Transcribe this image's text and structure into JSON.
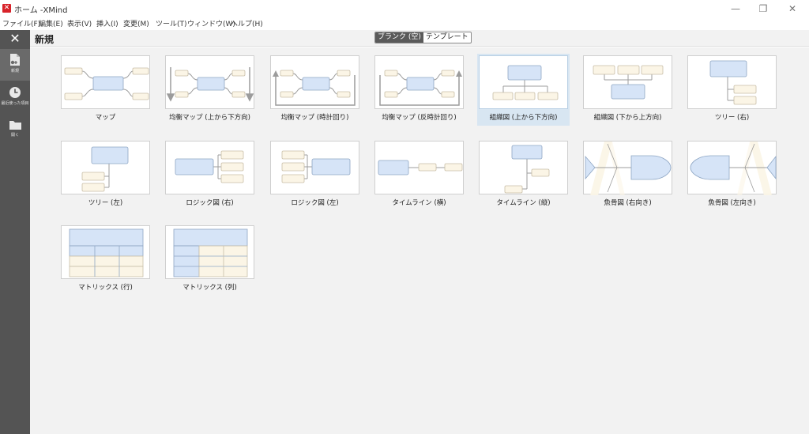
{
  "window": {
    "title": "ホーム -XMind",
    "controls": [
      "—",
      "❐",
      "✕"
    ]
  },
  "menu": [
    "ファイル(F)",
    "編集(E)",
    "表示(V)",
    "挿入(I)",
    "変更(M)",
    "ツール(T)",
    "ウィンドウ(W)",
    "ヘルプ(H)"
  ],
  "sidebar": {
    "close": "✕",
    "items": [
      {
        "label": "新規",
        "icon": "new-document-icon"
      },
      {
        "label": "最近使った項目",
        "icon": "clock-icon"
      },
      {
        "label": "開く",
        "icon": "folder-icon"
      }
    ]
  },
  "header": {
    "title": "新規",
    "segments": [
      "ブランク (空)",
      "テンプレート"
    ],
    "selected_segment": "ブランク (空)"
  },
  "templates": [
    {
      "label": "マップ",
      "kind": "map"
    },
    {
      "label": "均衡マップ (上から下方向)",
      "kind": "balanced-down"
    },
    {
      "label": "均衡マップ (時計回り)",
      "kind": "balanced-cw"
    },
    {
      "label": "均衡マップ (反時計回り)",
      "kind": "balanced-ccw"
    },
    {
      "label": "組織図 (上から下方向)",
      "kind": "org-down"
    },
    {
      "label": "組織図 (下から上方向)",
      "kind": "org-up"
    },
    {
      "label": "ツリー (右)",
      "kind": "tree-right"
    },
    {
      "label": "ツリー (左)",
      "kind": "tree-left"
    },
    {
      "label": "ロジック図 (右)",
      "kind": "logic-right"
    },
    {
      "label": "ロジック図 (左)",
      "kind": "logic-left"
    },
    {
      "label": "タイムライン (横)",
      "kind": "timeline-h"
    },
    {
      "label": "タイムライン (縦)",
      "kind": "timeline-v"
    },
    {
      "label": "魚骨図 (右向き)",
      "kind": "fish-right"
    },
    {
      "label": "魚骨図 (左向き)",
      "kind": "fish-left"
    },
    {
      "label": "マトリックス (行)",
      "kind": "matrix-row"
    },
    {
      "label": "マトリックス (列)",
      "kind": "matrix-col"
    }
  ],
  "selected_template": "組織図 (上から下方向)",
  "colors": {
    "central": "#d6e4f7",
    "central_stroke": "#8ea6c4",
    "topic": "#fbf5e6",
    "topic_stroke": "#c9bfa8",
    "line": "#9c9c9c",
    "selected_bg": "#d8e6f2",
    "sidebar_bg": "#545454"
  }
}
